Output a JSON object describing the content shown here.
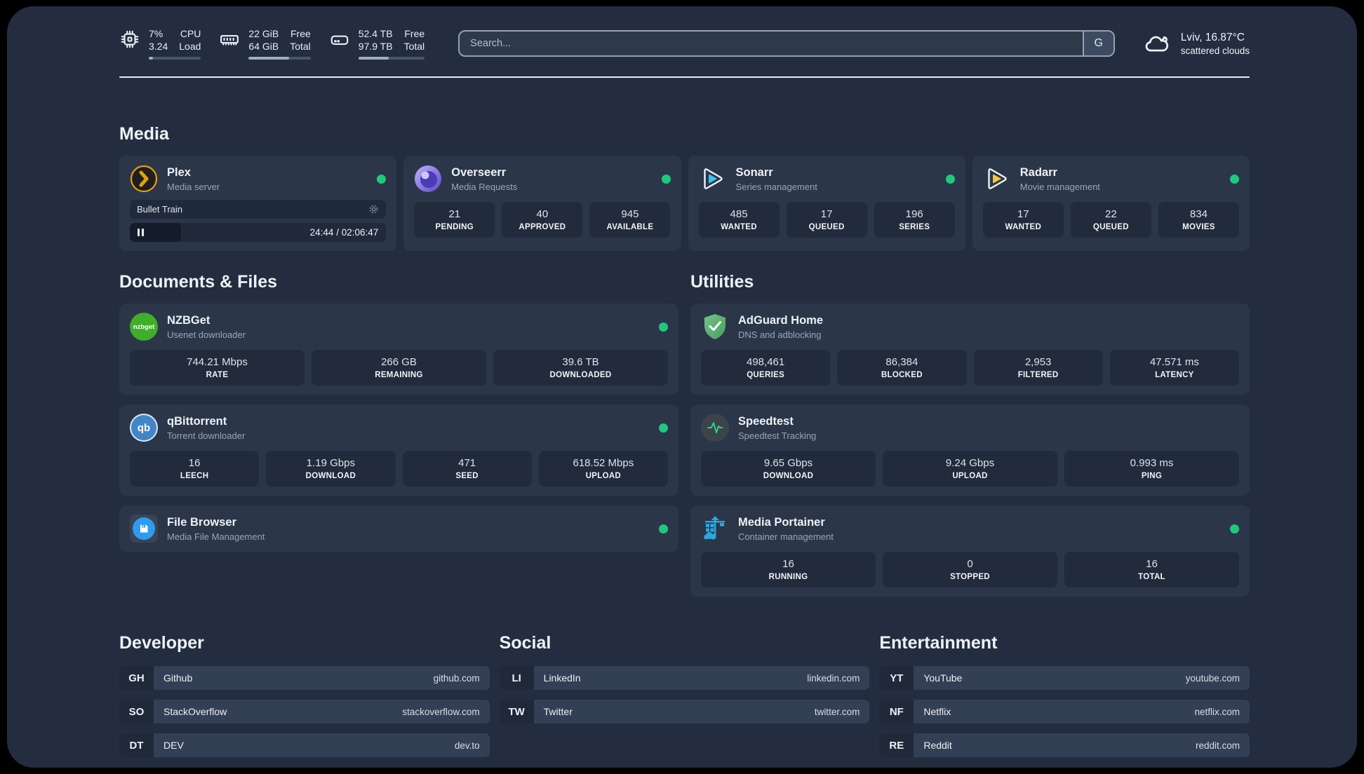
{
  "topbar": {
    "cpu": {
      "value1": "7%",
      "value2": "3.24",
      "label1": "CPU",
      "label2": "Load",
      "progress": 8
    },
    "ram": {
      "value1": "22 GiB",
      "value2": "64 GiB",
      "label1": "Free",
      "label2": "Total",
      "progress": 65
    },
    "disk": {
      "value1": "52.4 TB",
      "value2": "97.9 TB",
      "label1": "Free",
      "label2": "Total",
      "progress": 46
    },
    "search": {
      "placeholder": "Search...",
      "engine_label": "G"
    },
    "weather": {
      "location": "Lviv, 16.87°C",
      "condition": "scattered clouds"
    }
  },
  "media": {
    "title": "Media",
    "plex": {
      "name": "Plex",
      "desc": "Media server",
      "now_playing": "Bullet Train",
      "time": "24:44 / 02:06:47",
      "progress": 20
    },
    "overseerr": {
      "name": "Overseerr",
      "desc": "Media Requests",
      "stats": [
        {
          "value": "21",
          "label": "PENDING"
        },
        {
          "value": "40",
          "label": "APPROVED"
        },
        {
          "value": "945",
          "label": "AVAILABLE"
        }
      ]
    },
    "sonarr": {
      "name": "Sonarr",
      "desc": "Series management",
      "stats": [
        {
          "value": "485",
          "label": "WANTED"
        },
        {
          "value": "17",
          "label": "QUEUED"
        },
        {
          "value": "196",
          "label": "SERIES"
        }
      ]
    },
    "radarr": {
      "name": "Radarr",
      "desc": "Movie management",
      "stats": [
        {
          "value": "17",
          "label": "WANTED"
        },
        {
          "value": "22",
          "label": "QUEUED"
        },
        {
          "value": "834",
          "label": "MOVIES"
        }
      ]
    }
  },
  "documents": {
    "title": "Documents & Files",
    "nzbget": {
      "name": "NZBGet",
      "desc": "Usenet downloader",
      "icon_text": "nzbget",
      "stats": [
        {
          "value": "744.21 Mbps",
          "label": "RATE"
        },
        {
          "value": "266 GB",
          "label": "REMAINING"
        },
        {
          "value": "39.6 TB",
          "label": "DOWNLOADED"
        }
      ]
    },
    "qbittorrent": {
      "name": "qBittorrent",
      "desc": "Torrent downloader",
      "icon_text": "qb",
      "stats": [
        {
          "value": "16",
          "label": "LEECH"
        },
        {
          "value": "1.19 Gbps",
          "label": "DOWNLOAD"
        },
        {
          "value": "471",
          "label": "SEED"
        },
        {
          "value": "618.52 Mbps",
          "label": "UPLOAD"
        }
      ]
    },
    "filebrowser": {
      "name": "File Browser",
      "desc": "Media File Management"
    }
  },
  "utilities": {
    "title": "Utilities",
    "adguard": {
      "name": "AdGuard Home",
      "desc": "DNS and adblocking",
      "stats": [
        {
          "value": "498,461",
          "label": "QUERIES"
        },
        {
          "value": "86,384",
          "label": "BLOCKED"
        },
        {
          "value": "2,953",
          "label": "FILTERED"
        },
        {
          "value": "47.571 ms",
          "label": "LATENCY"
        }
      ]
    },
    "speedtest": {
      "name": "Speedtest",
      "desc": "Speedtest Tracking",
      "stats": [
        {
          "value": "9.65 Gbps",
          "label": "DOWNLOAD"
        },
        {
          "value": "9.24 Gbps",
          "label": "UPLOAD"
        },
        {
          "value": "0.993 ms",
          "label": "PING"
        }
      ]
    },
    "portainer": {
      "name": "Media Portainer",
      "desc": "Container management",
      "stats": [
        {
          "value": "16",
          "label": "RUNNING"
        },
        {
          "value": "0",
          "label": "STOPPED"
        },
        {
          "value": "16",
          "label": "TOTAL"
        }
      ]
    }
  },
  "links": {
    "developer": {
      "title": "Developer",
      "items": [
        {
          "abbr": "GH",
          "name": "Github",
          "url": "github.com"
        },
        {
          "abbr": "SO",
          "name": "StackOverflow",
          "url": "stackoverflow.com"
        },
        {
          "abbr": "DT",
          "name": "DEV",
          "url": "dev.to"
        }
      ]
    },
    "social": {
      "title": "Social",
      "items": [
        {
          "abbr": "LI",
          "name": "LinkedIn",
          "url": "linkedin.com"
        },
        {
          "abbr": "TW",
          "name": "Twitter",
          "url": "twitter.com"
        }
      ]
    },
    "entertainment": {
      "title": "Entertainment",
      "items": [
        {
          "abbr": "YT",
          "name": "YouTube",
          "url": "youtube.com"
        },
        {
          "abbr": "NF",
          "name": "Netflix",
          "url": "netflix.com"
        },
        {
          "abbr": "RE",
          "name": "Reddit",
          "url": "reddit.com"
        }
      ]
    }
  },
  "colors": {
    "status_green": "#1ec97d",
    "panel": "#232d3f",
    "card": "#2b3648"
  }
}
